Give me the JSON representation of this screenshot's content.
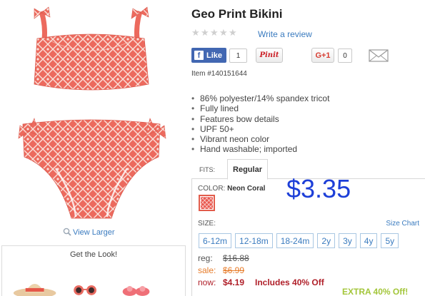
{
  "product": {
    "title": "Geo Print Bikini",
    "write_review": "Write a review",
    "item_number": "Item #140151644",
    "features": [
      "86% polyester/14% spandex tricot",
      "Fully lined",
      "Features bow details",
      "UPF 50+",
      "Vibrant neon color",
      "Hand washable; imported"
    ],
    "rating_stars": 0
  },
  "social": {
    "fb_like_label": "Like",
    "fb_count": "1",
    "pinit_label": "Pinit",
    "gplus_label": "G+1",
    "gplus_count": "0"
  },
  "gallery": {
    "view_larger": "View Larger",
    "get_the_look": "Get the Look!"
  },
  "fits": {
    "label": "FITS:",
    "selected": "Regular"
  },
  "color": {
    "label": "COLOR:",
    "value": "Neon Coral",
    "swatch_color": "#e9584f"
  },
  "overlay_price": "$3.35",
  "size": {
    "label": "SIZE:",
    "chart_link": "Size Chart",
    "options": [
      "6-12m",
      "12-18m",
      "18-24m",
      "2y",
      "3y",
      "4y",
      "5y"
    ]
  },
  "pricing": {
    "reg_label": "reg:",
    "reg_value": "$16.88",
    "sale_label": "sale:",
    "sale_value": "$6.99",
    "now_label": "now:",
    "now_value": "$4.19",
    "now_note": "Includes 40% Off",
    "extra_promo": "EXTRA 40% Off!"
  },
  "colors": {
    "link": "#3a7bbf",
    "coral": "#e9584f",
    "price_red": "#b0202a",
    "sale_orange": "#e77c2a",
    "overlay_blue": "#1d3fd8",
    "promo_green": "#a3c63a",
    "facebook": "#4267b2"
  }
}
